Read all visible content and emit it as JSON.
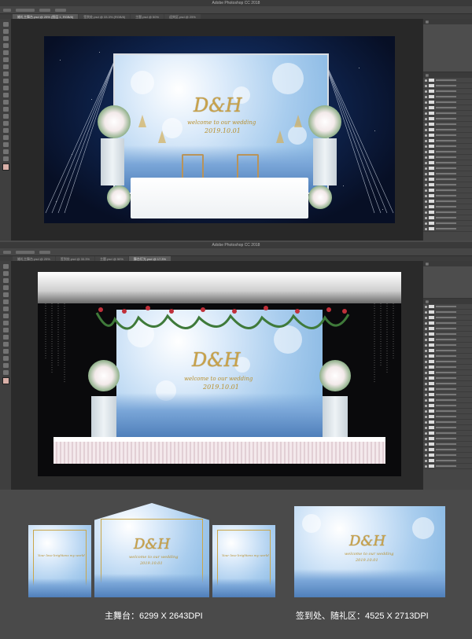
{
  "window1": {
    "title": "Adobe Photoshop CC 2018",
    "tabs": [
      "婚礼主舞台.psd @ 25% (图层 1, RGB/8)",
      "签到处.psd @ 33.3% (RGB/8)",
      "主题.psd @ 50%",
      "迎宾区.psd @ 25%"
    ]
  },
  "window2": {
    "title": "Adobe Photoshop CC 2018",
    "tabs": [
      "婚礼主舞台.psd @ 25%",
      "签到处.psd @ 33.3%",
      "主题.psd @ 50%",
      "舞台灯光.psd @ 17.3%"
    ]
  },
  "design": {
    "monogram": "D&H",
    "tagline": "welcome to our wedding",
    "date": "2019.10.01",
    "side_text": "Your love brightens my world"
  },
  "captions": {
    "main_stage": "主舞台：6299 X 2643DPI",
    "sign_in": "签到处、随礼区：4525 X 2713DPI"
  },
  "colors": {
    "ps_bg": "#535353",
    "canvas_bg": "#282828",
    "gold": "#c8a24a",
    "sky_blue": "#a9cdee"
  }
}
